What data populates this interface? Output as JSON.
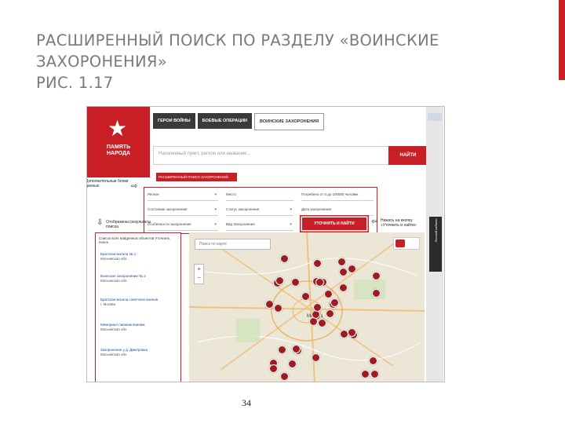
{
  "slide": {
    "title_lines": [
      "РАСШИРЕННЫЙ ПОИСК ПО РАЗДЕЛУ «ВОИНСКИЕ",
      "ЗАХОРОНЕНИЯ»",
      "РИС. 1.17"
    ],
    "page_number": "34",
    "accent_color": "#cc1f25"
  },
  "site": {
    "brand_lines": [
      "ПАМЯТЬ",
      "НАРОДА"
    ],
    "logo_icon": "star-icon",
    "nav_tabs": [
      "ГЕРОИ ВОЙНЫ",
      "БОЕВЫЕ ОПЕРАЦИИ",
      "ВОИНСКИЕ ЗАХОРОНЕНИЯ"
    ],
    "active_tab": "ВОИНСКИЕ ЗАХОРОНЕНИЯ",
    "search_placeholder": "Населенный пункт, регион или название...",
    "find_button": "НАЙТИ",
    "advanced_toggle": "РАСШИРЕННЫЙ ПОИСК ЗАХОРОНЕНИЙ",
    "filters": [
      "Регион",
      "Место",
      "Погребено от 0 до 100000 человек",
      "Состояние захоронения",
      "Статус захоронения",
      "Дата захоронения",
      "Особенности захоронения",
      "Вид Захоронения"
    ],
    "refine_button": "УТОЧНИТЬ И НАЙТИ",
    "map_search_placeholder": "Поиск по карте",
    "map_city": "Москва",
    "dark_panel_label": "Личный кабинет",
    "brand_color": "#c81e25"
  },
  "annotations": {
    "extra_fields": "Дополнительные блоки данных",
    "shown_results": "Отображены результаты поиска",
    "press_refine": "Нажать на кнопку «Уточнить и найти»"
  },
  "results": {
    "header": "Список всех найденных объектов Уточнить поиск",
    "items": [
      {
        "title": "Братская могила № 1",
        "sub": "Московская обл."
      },
      {
        "title": "Воинское захоронение № 2",
        "sub": "Московская обл."
      },
      {
        "title": "Братская могила советских воинов",
        "sub": "г. Москва"
      },
      {
        "title": "Мемориал павшим воинам",
        "sub": "Московская обл."
      },
      {
        "title": "Захоронение у д. Дмитровка",
        "sub": "Московская обл."
      }
    ]
  },
  "map_markers": 40
}
